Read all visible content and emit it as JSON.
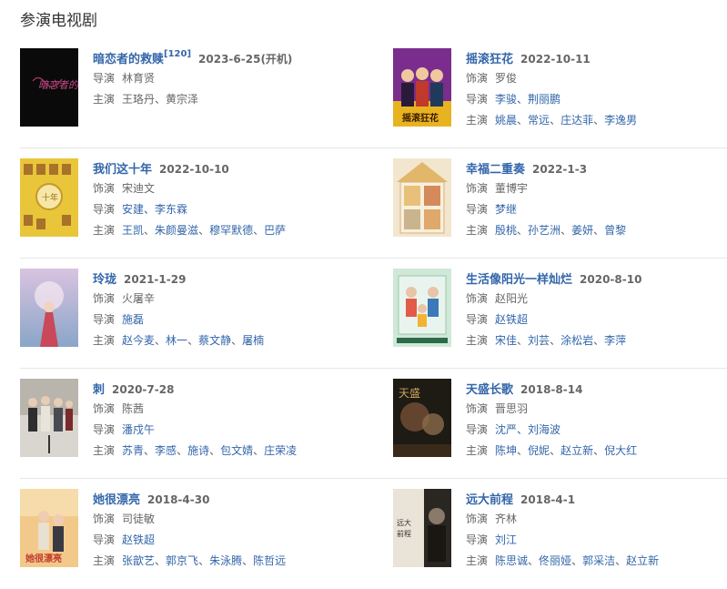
{
  "section_title": "参演电视剧",
  "labels": {
    "director": "导演",
    "starring": "主演",
    "role": "饰演"
  },
  "dramas": [
    {
      "title": "暗恋者的救赎",
      "ref": "[120]",
      "date": "2023-6-25(开机)",
      "poster_icon": "poster-anlianzhe",
      "poster_text": "暗恋者的救赎",
      "role": null,
      "director": {
        "text": "林育贤",
        "link": false
      },
      "cast": [
        "王珞丹",
        "黄宗泽"
      ],
      "cast_link": false
    },
    {
      "title": "摇滚狂花",
      "ref": null,
      "date": "2022-10-11",
      "poster_icon": "poster-yaogun",
      "role": "罗俊",
      "director": {
        "text": "李骏、荆丽鹏",
        "link": true
      },
      "cast": [
        "姚晨",
        "常远",
        "庄达菲",
        "李逸男"
      ],
      "cast_link": true
    },
    {
      "title": "我们这十年",
      "ref": null,
      "date": "2022-10-10",
      "poster_icon": "poster-women",
      "role": "宋迪文",
      "director": {
        "text": "安建、李东霖",
        "link": true
      },
      "cast": [
        "王凯",
        "朱颜曼滋",
        "穆罕默德",
        "巴萨"
      ],
      "cast_link": true
    },
    {
      "title": "幸福二重奏",
      "ref": null,
      "date": "2022-1-3",
      "poster_icon": "poster-xingfu",
      "role": "董博宇",
      "director": {
        "text": "梦继",
        "link": true
      },
      "cast": [
        "殷桃",
        "孙艺洲",
        "姜妍",
        "曾黎"
      ],
      "cast_link": true
    },
    {
      "title": "玲珑",
      "ref": null,
      "date": "2021-1-29",
      "poster_icon": "poster-linglong",
      "role": "火屠辛",
      "director": {
        "text": "施磊",
        "link": true
      },
      "cast": [
        "赵今麦",
        "林一",
        "蔡文静",
        "屠楠"
      ],
      "cast_link": true
    },
    {
      "title": "生活像阳光一样灿烂",
      "ref": null,
      "date": "2020-8-10",
      "poster_icon": "poster-shenghuo",
      "role": "赵阳光",
      "director": {
        "text": "赵铁超",
        "link": true
      },
      "cast": [
        "宋佳",
        "刘芸",
        "涂松岩",
        "李萍"
      ],
      "cast_link": true
    },
    {
      "title": "刺",
      "ref": null,
      "date": "2020-7-28",
      "poster_icon": "poster-ci",
      "role": "陈茜",
      "director": {
        "text": "潘戍午",
        "link": true
      },
      "cast": [
        "苏青",
        "李感",
        "施诗",
        "包文婧",
        "庄荣凌"
      ],
      "cast_link": true
    },
    {
      "title": "天盛长歌",
      "ref": null,
      "date": "2018-8-14",
      "poster_icon": "poster-tiansheng",
      "role": "晋思羽",
      "director": {
        "text": "沈严、刘海波",
        "link": true
      },
      "cast": [
        "陈坤",
        "倪妮",
        "赵立新",
        "倪大红"
      ],
      "cast_link": true
    },
    {
      "title": "她很漂亮",
      "ref": null,
      "date": "2018-4-30",
      "poster_icon": "poster-tahen",
      "role": "司徒敏",
      "director": {
        "text": "赵铁超",
        "link": true
      },
      "cast": [
        "张歆艺",
        "郭京飞",
        "朱泳腾",
        "陈哲远"
      ],
      "cast_link": true
    },
    {
      "title": "远大前程",
      "ref": null,
      "date": "2018-4-1",
      "poster_icon": "poster-yuanda",
      "role": "齐林",
      "director": {
        "text": "刘江",
        "link": true
      },
      "cast": [
        "陈思诚",
        "佟丽娅",
        "郭采洁",
        "赵立新"
      ],
      "cast_link": true
    }
  ],
  "colors": {
    "link": "#3366aa",
    "label": "#666666",
    "divider": "#e6e6e6"
  }
}
